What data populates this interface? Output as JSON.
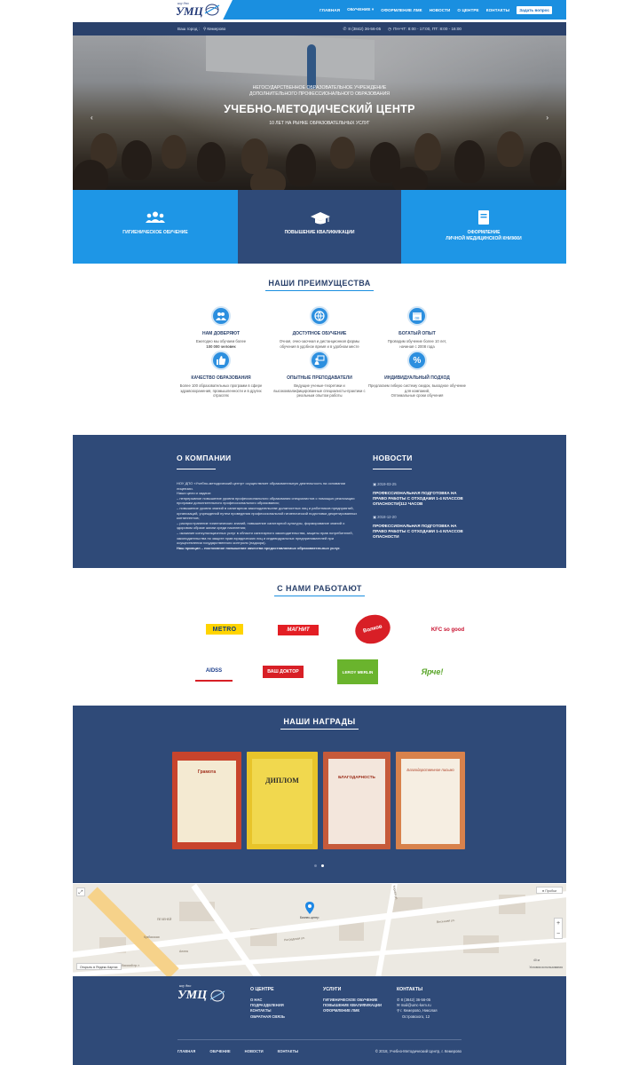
{
  "header": {
    "logo_top": "ноу дпо",
    "logo_main": "УМЦ",
    "nav": [
      "Главная",
      "Обучение",
      "Оформление ЛМК",
      "Новости",
      "О центре",
      "Контакты"
    ],
    "nav_dropdown_index": 1,
    "ask_button": "Задать вопрос"
  },
  "infobar": {
    "city_label": "Ваш город :",
    "city": "Кемерово",
    "phone": "8 (3842) 36-56-05",
    "hours": "ПН-ЧТ: 8:00 - 17:00, ПТ: 8:00 - 16:00"
  },
  "hero": {
    "subtitle_line1": "НЕГОСУДАРСТВЕННОЕ ОБРАЗОВАТЕЛЬНОЕ УЧРЕЖДЕНИЕ",
    "subtitle_line2": "ДОПОЛНИТЕЛЬНОГО ПРОФЕССИОНАЛЬНОГО ОБРАЗОВАНИЯ",
    "title": "УЧЕБНО-МЕТОДИЧЕСКИЙ ЦЕНТР",
    "tagline": "10 ЛЕТ НА РЫНКЕ ОБРАЗОВАТЕЛЬНЫХ УСЛУГ",
    "prev": "‹",
    "next": "›"
  },
  "tiles": [
    {
      "label": "Гигиеническое обучение",
      "icon": "users-icon",
      "color": "#1e96e6"
    },
    {
      "label": "Повышение квалификации",
      "icon": "graduation-cap-icon",
      "color": "#2f4a78"
    },
    {
      "label": "Оформление",
      "label2": "личной медицинской книжки",
      "icon": "book-icon",
      "color": "#1e96e6"
    }
  ],
  "advantages": {
    "title": "Наши преимущества",
    "items": [
      {
        "title": "Нам доверяют",
        "text": "Ежегодно мы обучаем более",
        "text2": "100 000 человек",
        "icon": "handshake-icon"
      },
      {
        "title": "Доступное обучение",
        "text": "Очная, очно-заочная и дистанционная формы",
        "text2": "обучения в удобное время и в удобном месте",
        "icon": "globe-icon"
      },
      {
        "title": "Богатый опыт",
        "text": "Проводим обучение более 10 лет,",
        "text2": "начиная с 2008 года",
        "icon": "calendar-icon"
      },
      {
        "title": "Качество образования",
        "text": "Более 100 образовательных программ в сфере",
        "text2": "здравоохранения, промышленности и в других отраслях",
        "icon": "thumbs-up-icon"
      },
      {
        "title": "Опытные преподаватели",
        "text": "Ведущие ученые-теоретики и",
        "text2": "высококвалифицированные специалисты-практики с реальным опытом работы",
        "icon": "teacher-icon"
      },
      {
        "title": "Индивидуальный подход",
        "text": "Предлагаем гибкую систему скидок, выходное обучение для компаний,",
        "text2": "Оптимальные сроки обучения",
        "icon": "percent-icon"
      }
    ]
  },
  "company": {
    "title": "О компании",
    "paragraphs": [
      "НОУ ДПО «Учебно-методический центр» осуществляет образовательную деятельность на основании лицензии.",
      "Наши цели и задачи:",
      "– непрерывное повышение уровня профессионального образования специалистов с помощью реализации программ дополнительного профессионального образования;",
      "– повышение уровня знаний в санитарном законодательстве должностных лиц и работников предприятий, организаций, учреждений путем проведения профессиональной гигиенической подготовки декретированных контингентов;",
      "– распространение гигиенических знаний, повышение санитарной культуры, формирование знаний о здоровом образе жизни среди населения;",
      "– оказание консультационных услуг в области санитарного законодательства, защиты прав потребителей, законодательства по защите прав юридических лиц и индивидуальных предпринимателей при осуществлении государственного контроля (надзора).",
      "Наш принцип – постоянное повышение качества предоставляемых образовательных услуг."
    ]
  },
  "news": {
    "title": "Новости",
    "items": [
      {
        "date": "2019-03-25",
        "title": "ПРОФЕССИОНАЛЬНАЯ ПОДГОТОВКА НА ПРАВО РАБОТЫ С ОТХОДАМИ 1-4 КЛАССОВ ОПАСНОСТИ(112 ЧАСОВ"
      },
      {
        "date": "2018-12-20",
        "title": "ПРОФЕССИОНАЛЬНАЯ ПОДГОТОВКА НА ПРАВО РАБОТЫ С ОТХОДАМИ 1-4 КЛАССОВ ОПАСНОСТИ"
      }
    ]
  },
  "partners": {
    "title": "С нами работают",
    "logos": [
      "METRO",
      "МАГНИТ",
      "Волков",
      "KFC so good",
      "AIDSS",
      "ВАШ ДОКТОР",
      "LEROY MERLIN",
      "Ярче!"
    ]
  },
  "awards": {
    "title": "Наши награды",
    "certs": [
      "Грамота",
      "ДИПЛОМ",
      "БЛАГОДАРНОСТЬ",
      "Благодарственное письмо"
    ],
    "cert_colors": [
      "#c8442c",
      "#e8c42a",
      "#c65a3a",
      "#d8824c"
    ],
    "dots": 2,
    "active_dot": 1
  },
  "map": {
    "traffic_label": "Пробки",
    "open_in": "Открыть в Яндекс.Картах",
    "terms": "Условия использования",
    "scale": "40 м",
    "labels": [
      "ПЕЧЕНЕЙ",
      "Кузбасская",
      "Аллея",
      "Ноградская ул.",
      "Кузбасский пр-т",
      "Весенняя ул.",
      "Кирова ул."
    ],
    "marker_label": "Бизнес-центр"
  },
  "footer": {
    "logo_top": "ноу дпо",
    "logo_main": "УМЦ",
    "about_title": "О центре",
    "about_links": [
      "О нас",
      "Подразделения",
      "Контакты",
      "Обратная связь"
    ],
    "services_title": "Услуги",
    "services_links": [
      "Гигиеническое обучение",
      "Повышение квалификации",
      "Оформление ЛМК"
    ],
    "contacts_title": "Контакты",
    "phone": "8 (3842) 36-56-05",
    "email": "mail@umc-kem.ru",
    "address1": "г. Кемерово, Николая",
    "address2": "Островского, 12",
    "bottom_links": [
      "Главная",
      "Обучение",
      "Новости",
      "Контакты"
    ],
    "copyright": "© 2018, Учебно-Методический Центр, г. Кемерово"
  }
}
